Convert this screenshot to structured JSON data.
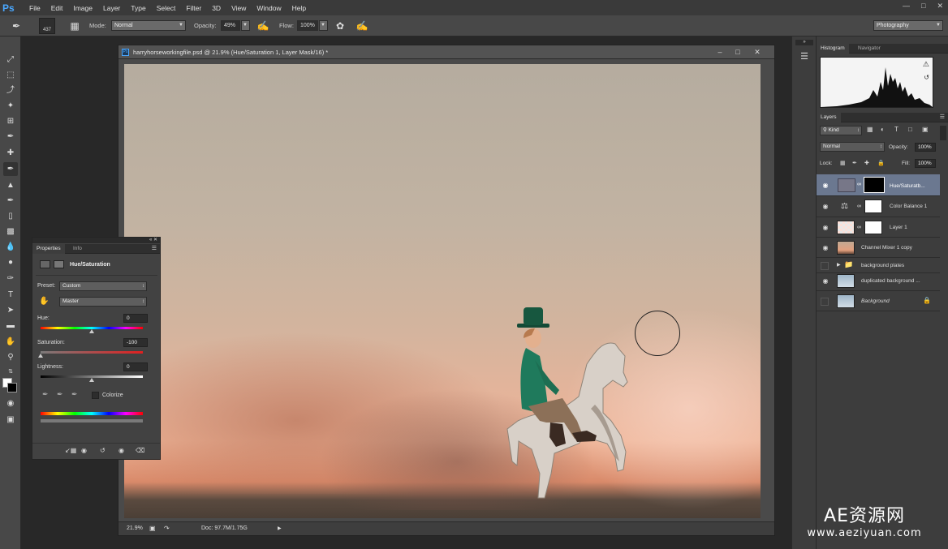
{
  "app": {
    "logo": "Ps"
  },
  "menu": [
    "File",
    "Edit",
    "Image",
    "Layer",
    "Type",
    "Select",
    "Filter",
    "3D",
    "View",
    "Window",
    "Help"
  ],
  "options": {
    "brush_size": "437",
    "mode_label": "Mode:",
    "mode_value": "Normal",
    "opacity_label": "Opacity:",
    "opacity_value": "49%",
    "flow_label": "Flow:",
    "flow_value": "100%",
    "workspace": "Photography"
  },
  "document": {
    "title": "harryhorseworkingfile.psd @ 21.9% (Hue/Saturation 1, Layer Mask/16) *",
    "zoom": "21.9%",
    "doc_size": "Doc: 97.7M/1.75G"
  },
  "histogram_panel": {
    "tabs": [
      "Histogram",
      "Navigator"
    ]
  },
  "layers_panel": {
    "tab": "Layers",
    "kind": "Kind",
    "blend": "Normal",
    "opacity_label": "Opacity:",
    "opacity_value": "100%",
    "lock_label": "Lock:",
    "fill_label": "Fill:",
    "fill_value": "100%",
    "layers": [
      {
        "name": "Hue/Saturatb...",
        "visible": true,
        "selected": true
      },
      {
        "name": "Color Balance 1",
        "visible": true
      },
      {
        "name": "Layer 1",
        "visible": true
      },
      {
        "name": "Channel Mixer 1 copy",
        "visible": true
      },
      {
        "name": "background plates",
        "visible": false
      },
      {
        "name": "duplicated background ...",
        "visible": true
      },
      {
        "name": "Background",
        "visible": false
      }
    ]
  },
  "properties": {
    "tabs": [
      "Properties",
      "Info"
    ],
    "title": "Hue/Saturation",
    "preset_label": "Preset:",
    "preset_value": "Custom",
    "channel": "Master",
    "hue_label": "Hue:",
    "hue_value": "0",
    "saturation_label": "Saturation:",
    "saturation_value": "-100",
    "lightness_label": "Lightness:",
    "lightness_value": "0",
    "colorize_label": "Colorize"
  },
  "watermark": {
    "line1": "AE资源网",
    "line2": "www.aeziyuan.com"
  }
}
